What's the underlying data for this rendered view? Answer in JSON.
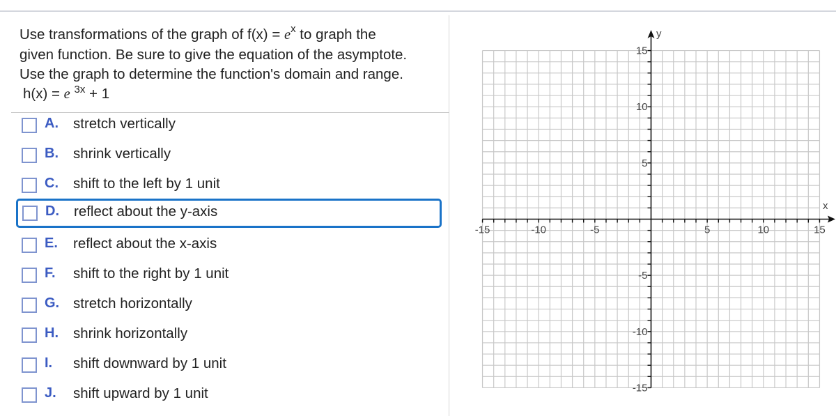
{
  "question": {
    "prefix": "Use transformations of the graph of f(x) = ",
    "base_e": "e",
    "base_exp": "x",
    "suffix": " to graph the given function. Be sure to give the equation of the asymptote. Use the graph to determine the function's domain and range.",
    "line1a": "Use transformations of the graph of f(x) = ",
    "line1b": " to graph the",
    "line2": "given function. Be sure to give the equation of the asymptote.",
    "line3": "Use the graph to determine the function's domain and range.",
    "function": {
      "lhs": "h(x) = ",
      "e": "e",
      "exp": "3x",
      "rhs": " + 1"
    }
  },
  "options": [
    {
      "letter": "A.",
      "label": "stretch vertically",
      "checked": false,
      "focused": false
    },
    {
      "letter": "B.",
      "label": "shrink vertically",
      "checked": false,
      "focused": false
    },
    {
      "letter": "C.",
      "label": "shift to the left by 1 unit",
      "checked": false,
      "focused": false
    },
    {
      "letter": "D.",
      "label": "reflect about the y-axis",
      "checked": false,
      "focused": true
    },
    {
      "letter": "E.",
      "label": "reflect about the x-axis",
      "checked": false,
      "focused": false
    },
    {
      "letter": "F.",
      "label": "shift to the right by 1 unit",
      "checked": false,
      "focused": false
    },
    {
      "letter": "G.",
      "label": "stretch horizontally",
      "checked": false,
      "focused": false
    },
    {
      "letter": "H.",
      "label": "shrink horizontally",
      "checked": false,
      "focused": false
    },
    {
      "letter": "I.",
      "label": "shift downward by 1 unit",
      "checked": false,
      "focused": false
    },
    {
      "letter": "J.",
      "label": "shift upward by 1 unit",
      "checked": false,
      "focused": false
    }
  ],
  "graph": {
    "x_label": "x",
    "y_label": "y",
    "x_range": [
      -15,
      15
    ],
    "y_range": [
      -15,
      15
    ],
    "grid_step": 1,
    "label_step": 5,
    "x_tick_labels": [
      "-15",
      "-10",
      "-5",
      "5",
      "10",
      "15"
    ],
    "y_tick_labels": [
      "15",
      "10",
      "5",
      "-5",
      "-10",
      "-15"
    ],
    "colors": {
      "grid": "#c8c8c8",
      "axis": "#111111"
    }
  }
}
